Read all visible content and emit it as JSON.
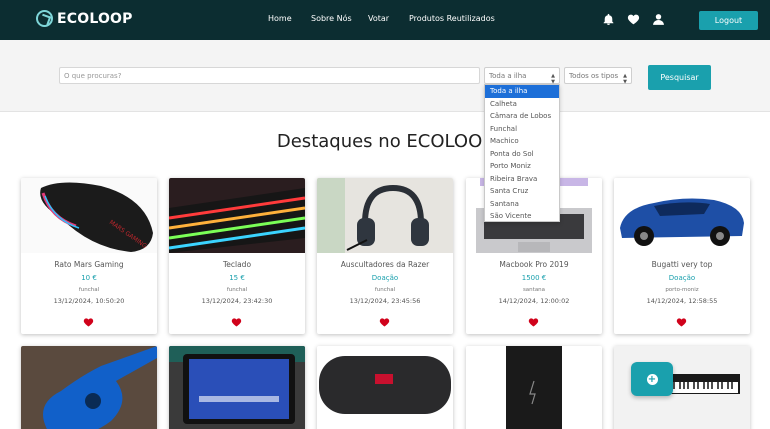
{
  "brand": {
    "name": "ECOLOOP"
  },
  "nav": {
    "links": [
      "Home",
      "Sobre Nós",
      "Votar",
      "Produtos Reutilizados"
    ],
    "icons": [
      "bell-icon",
      "heart-icon",
      "user-icon"
    ],
    "logout_label": "Logout"
  },
  "search": {
    "placeholder": "O que procuras?",
    "region_selected": "Toda a ilha",
    "type_selected": "Todos os tipos",
    "button_label": "Pesquisar"
  },
  "region_options": [
    "Toda a ilha",
    "Calheta",
    "Câmara de Lobos",
    "Funchal",
    "Machico",
    "Ponta do Sol",
    "Porto Moniz",
    "Ribeira Brava",
    "Santa Cruz",
    "Santana",
    "São Vicente"
  ],
  "heading": "Destaques no ECOLOOP",
  "products": [
    {
      "title": "Rato Mars Gaming",
      "price": "10 €",
      "location": "funchal",
      "date": "13/12/2024, 10:50:20"
    },
    {
      "title": "Teclado",
      "price": "15 €",
      "location": "funchal",
      "date": "13/12/2024, 23:42:30"
    },
    {
      "title": "Auscultadores da Razer",
      "price": "Doação",
      "location": "funchal",
      "date": "13/12/2024, 23:45:56"
    },
    {
      "title": "Macbook Pro 2019",
      "price": "1500 €",
      "location": "santana",
      "date": "14/12/2024, 12:00:02"
    },
    {
      "title": "Bugatti very top",
      "price": "Doação",
      "location": "porto-moniz",
      "date": "14/12/2024, 12:58:55"
    }
  ],
  "colors": {
    "navbar": "#0c2d31",
    "accent": "#1aa0ad",
    "favorite": "#d0021b",
    "dropdown_selected": "#1d6fd8"
  }
}
